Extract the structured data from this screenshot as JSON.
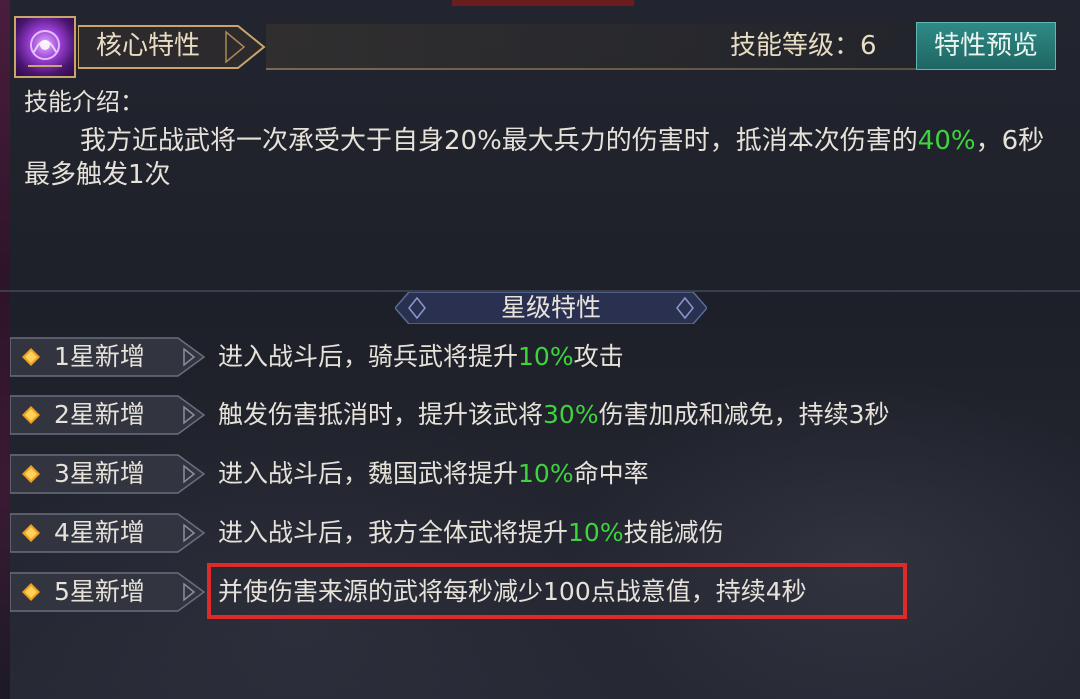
{
  "header": {
    "icon": "purple-skill-orb-icon",
    "title": "核心特性",
    "level_text": "技能等级：6",
    "preview_button": "特性预览"
  },
  "intro": {
    "label": "技能介绍：",
    "text_part1": "我方近战武将一次承受大于自身20%最大兵力的伤害时，抵消本次伤害的",
    "highlight": "40%",
    "text_part2": "，6秒最多触发1次"
  },
  "star_section": {
    "title": "星级特性",
    "rows": [
      {
        "label": "1星新增",
        "pre": "进入战斗后，骑兵武将提升",
        "hl": "10%",
        "post": "攻击"
      },
      {
        "label": "2星新增",
        "pre": "触发伤害抵消时，提升该武将",
        "hl": "30%",
        "post": "伤害加成和减免，持续3秒"
      },
      {
        "label": "3星新增",
        "pre": "进入战斗后，魏国武将提升",
        "hl": "10%",
        "post": "命中率"
      },
      {
        "label": "4星新增",
        "pre": "进入战斗后，我方全体武将提升",
        "hl": "10%",
        "post": "技能减伤"
      },
      {
        "label": "5星新增",
        "pre": "并使伤害来源的武将每秒减少100点战意值，持续4秒",
        "hl": "",
        "post": ""
      }
    ]
  },
  "colors": {
    "highlight_green": "#3dd43d",
    "annotation_red": "#e02a2a",
    "button_teal": "#2f8a86"
  }
}
